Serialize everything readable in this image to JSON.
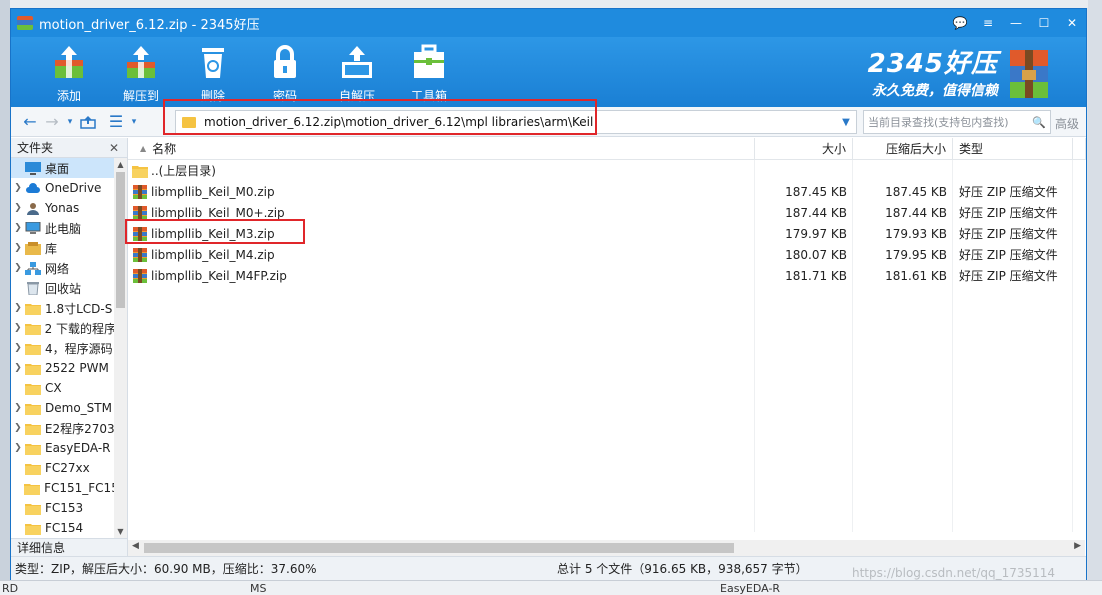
{
  "window": {
    "title": "motion_driver_6.12.zip - 2345好压",
    "controls": [
      "💬",
      "≡",
      "—",
      "☐",
      "✕"
    ]
  },
  "toolbar": {
    "add": "添加",
    "extract_to": "解压到",
    "delete": "删除",
    "password": "密码",
    "self_extract": "自解压",
    "toolbox": "工具箱"
  },
  "brand": {
    "name": "2345好压",
    "slogan": "永久免费，值得信赖"
  },
  "address": {
    "path": "motion_driver_6.12.zip\\motion_driver_6.12\\mpl libraries\\arm\\Keil"
  },
  "search": {
    "placeholder": "当前目录查找(支持包内查找)",
    "advanced": "高级"
  },
  "sidebar": {
    "header": "文件夹",
    "footer": "详细信息",
    "items": [
      {
        "label": "桌面",
        "icon": "desktop-icon",
        "expandable": false,
        "selected": true
      },
      {
        "label": "OneDrive",
        "icon": "cloud-icon",
        "expandable": true
      },
      {
        "label": "Yonas",
        "icon": "user-icon",
        "expandable": true
      },
      {
        "label": "此电脑",
        "icon": "computer-icon",
        "expandable": true
      },
      {
        "label": "库",
        "icon": "library-icon",
        "expandable": true
      },
      {
        "label": "网络",
        "icon": "network-icon",
        "expandable": true
      },
      {
        "label": "回收站",
        "icon": "recycle-bin-icon",
        "expandable": false
      },
      {
        "label": "1.8寸LCD-S",
        "icon": "folder-icon",
        "expandable": true
      },
      {
        "label": "2 下载的程序",
        "icon": "folder-icon",
        "expandable": true
      },
      {
        "label": "4，程序源码",
        "icon": "folder-icon",
        "expandable": true
      },
      {
        "label": "2522 PWM",
        "icon": "folder-icon",
        "expandable": true
      },
      {
        "label": "CX",
        "icon": "folder-icon",
        "expandable": false
      },
      {
        "label": "Demo_STM",
        "icon": "folder-icon",
        "expandable": true
      },
      {
        "label": "E2程序2703",
        "icon": "folder-icon",
        "expandable": true
      },
      {
        "label": "EasyEDA-R",
        "icon": "folder-icon",
        "expandable": true
      },
      {
        "label": "FC27xx",
        "icon": "folder-icon",
        "expandable": false
      },
      {
        "label": "FC151_FC15",
        "icon": "folder-icon",
        "expandable": false
      },
      {
        "label": "FC153",
        "icon": "folder-icon",
        "expandable": false
      },
      {
        "label": "FC154",
        "icon": "folder-icon",
        "expandable": false
      }
    ]
  },
  "columns": {
    "name": "名称",
    "size": "大小",
    "compressed": "压缩后大小",
    "type": "类型"
  },
  "files": [
    {
      "name": "..(上层目录)",
      "size": "",
      "compressed": "",
      "type": "",
      "icon": "folder-up-icon"
    },
    {
      "name": "libmpllib_Keil_M0.zip",
      "size": "187.45 KB",
      "compressed": "187.45 KB",
      "type": "好压 ZIP 压缩文件",
      "icon": "zip-icon"
    },
    {
      "name": "libmpllib_Keil_M0+.zip",
      "size": "187.44 KB",
      "compressed": "187.44 KB",
      "type": "好压 ZIP 压缩文件",
      "icon": "zip-icon"
    },
    {
      "name": "libmpllib_Keil_M3.zip",
      "size": "179.97 KB",
      "compressed": "179.93 KB",
      "type": "好压 ZIP 压缩文件",
      "icon": "zip-icon"
    },
    {
      "name": "libmpllib_Keil_M4.zip",
      "size": "180.07 KB",
      "compressed": "179.95 KB",
      "type": "好压 ZIP 压缩文件",
      "icon": "zip-icon"
    },
    {
      "name": "libmpllib_Keil_M4FP.zip",
      "size": "181.71 KB",
      "compressed": "181.61 KB",
      "type": "好压 ZIP 压缩文件",
      "icon": "zip-icon"
    }
  ],
  "status": {
    "left": "类型：ZIP，解压后大小：60.90 MB，压缩比：37.60%",
    "right": "总计 5 个文件（916.65 KB，938,657 字节）"
  },
  "background": {
    "bottom_left": "RD",
    "bottom_mid": "MS",
    "bottom_right": "EasyEDA-R"
  },
  "watermark": "https://blog.csdn.net/qq_1735114",
  "colors": {
    "accent": "#1f8bde",
    "highlight": "#e0262a",
    "selection": "#cce5fb"
  }
}
